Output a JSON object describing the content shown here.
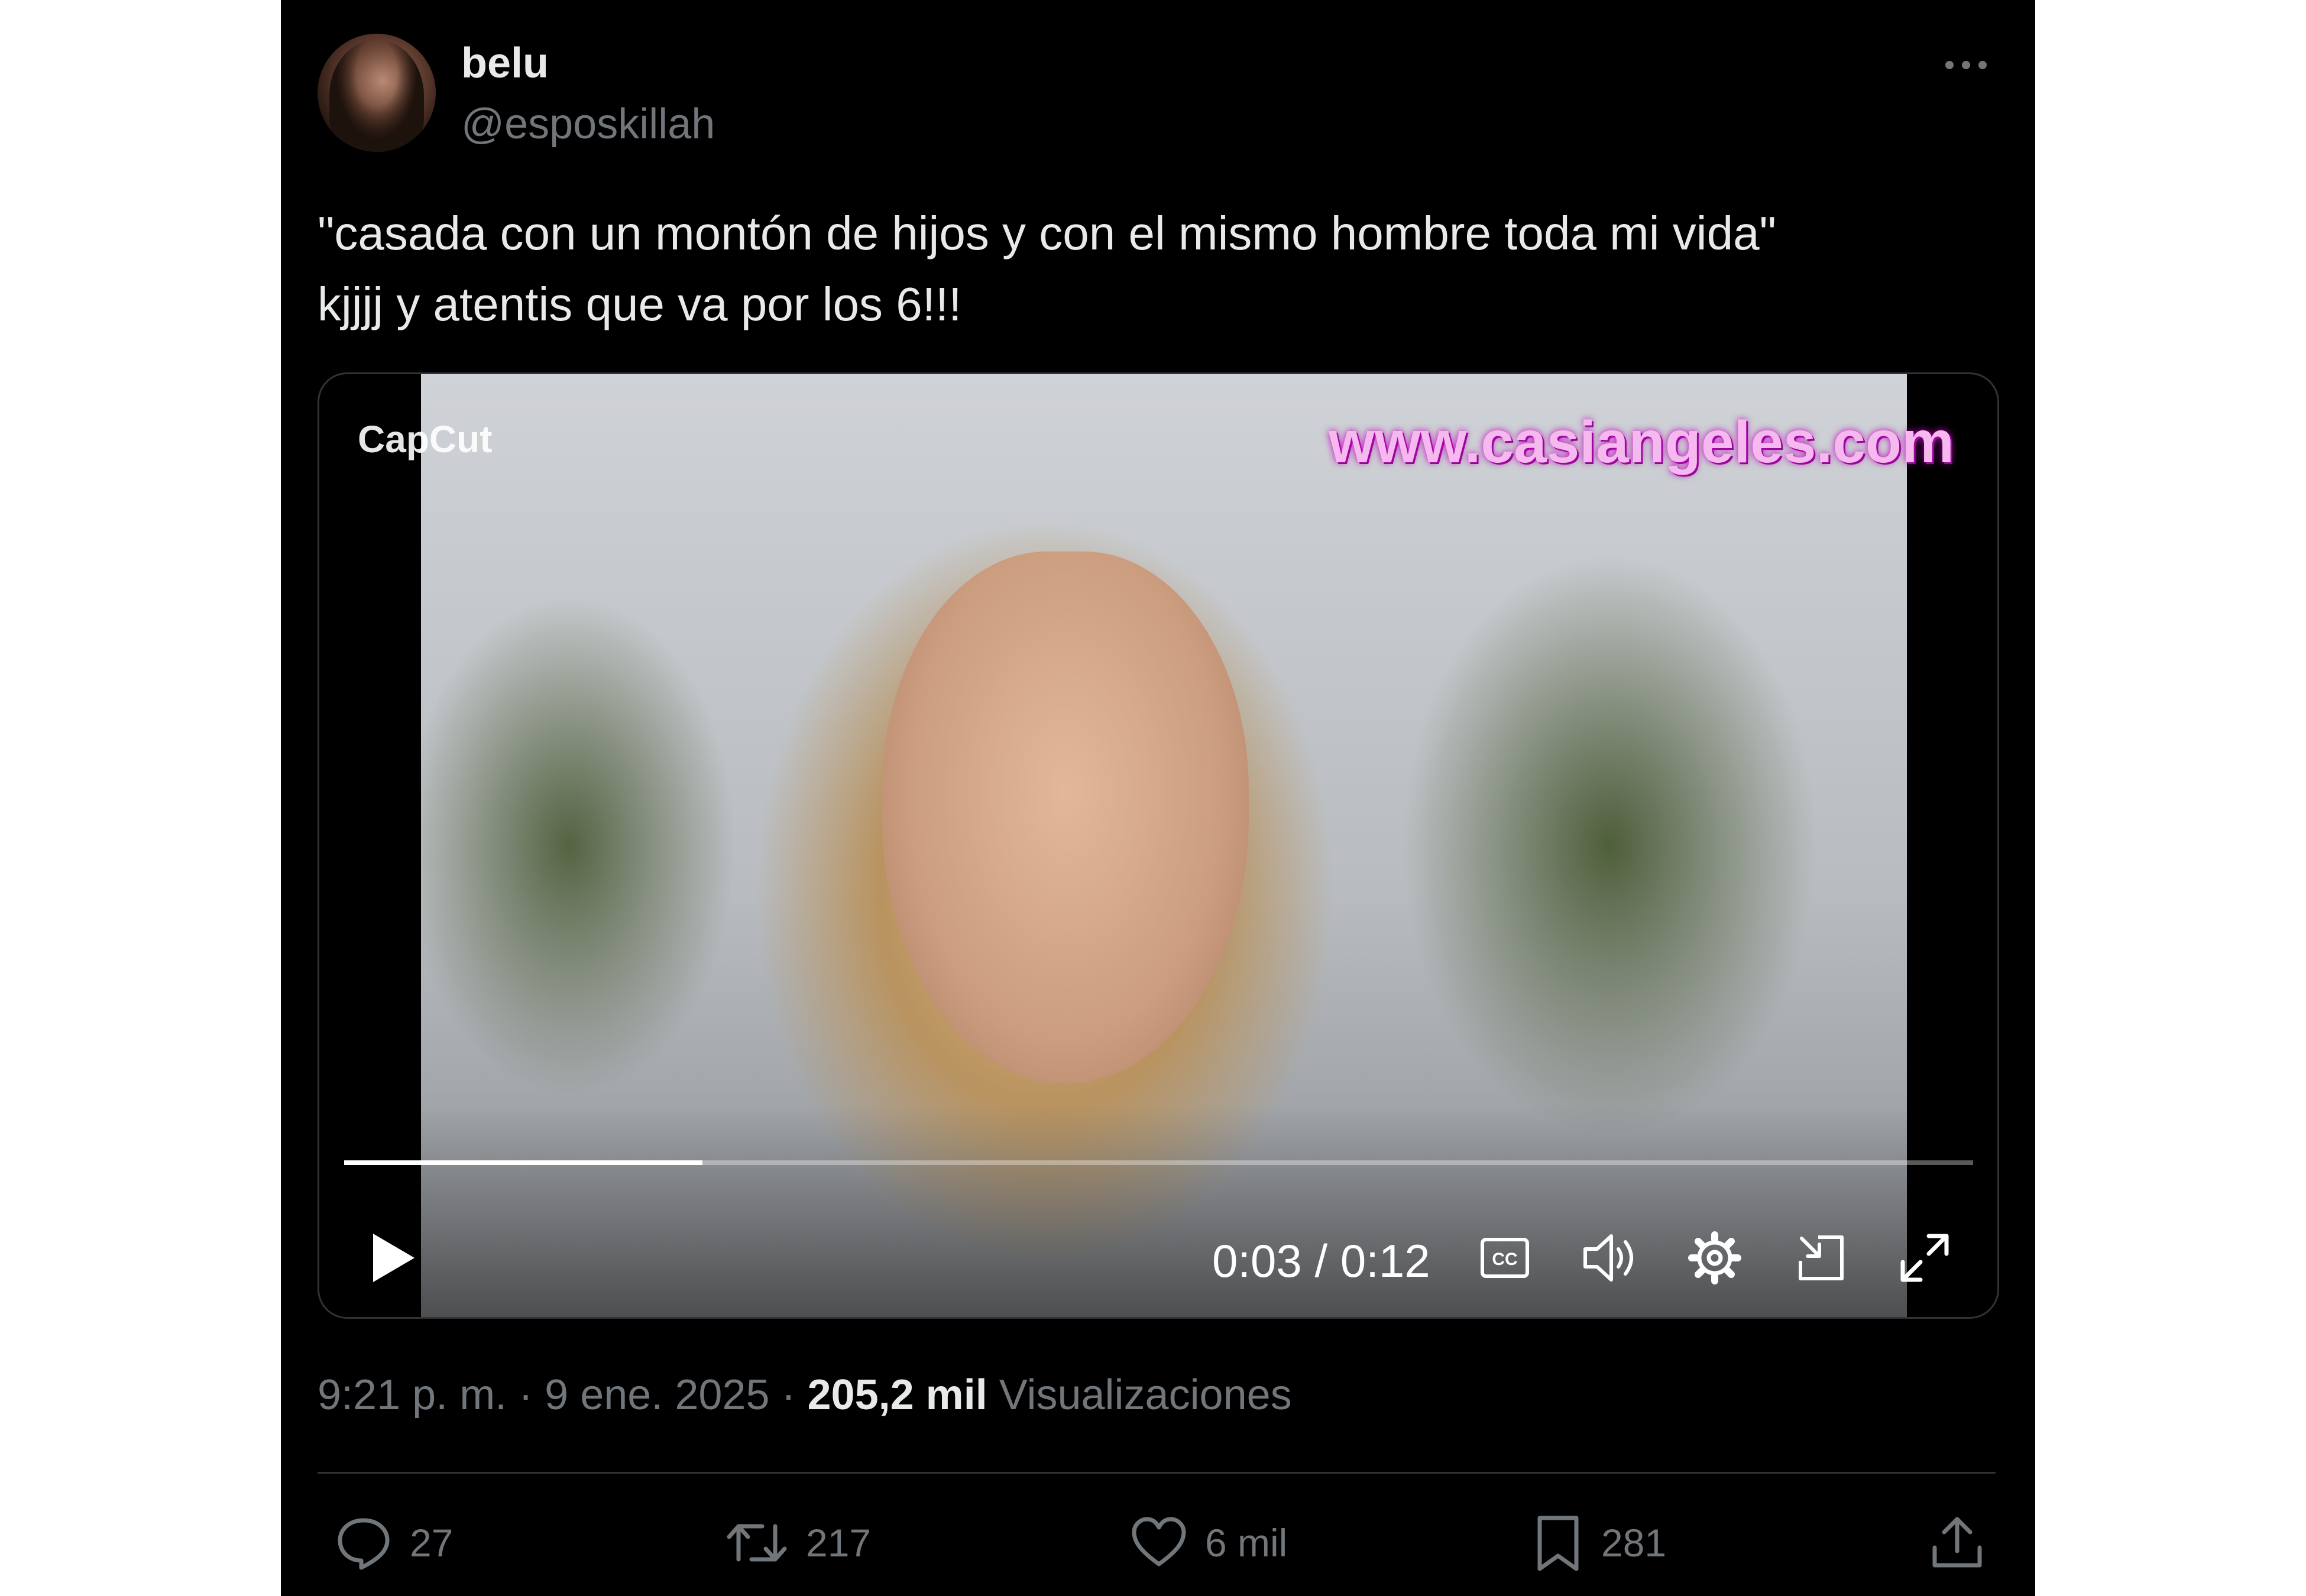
{
  "author": {
    "display_name": "belu",
    "handle": "@esposkillah",
    "avatar_icon": "avatar-photo"
  },
  "tweet": {
    "text_line1": "\"casada con un montón de hijos y con el mismo hombre toda mi vida\"",
    "text_line2": "kjjjj y atentis que va por los 6!!!"
  },
  "media": {
    "watermark_url": "www.casiangeles.com",
    "capcut_label": "CapCut",
    "time_display": "0:03 / 0:12",
    "progress_fraction": 0.22
  },
  "meta": {
    "time": "9:21 p. m.",
    "sep1": " · ",
    "date": "9 ene. 2025",
    "sep2": " · ",
    "views_count": "205,2 mil",
    "views_label": " Visualizaciones"
  },
  "actions": {
    "replies": "27",
    "reposts": "217",
    "likes": "6 mil",
    "bookmarks": "281"
  },
  "colors": {
    "background": "#000000",
    "text_primary": "#e7e9ea",
    "text_secondary": "#71767b",
    "border": "#2f3336"
  }
}
